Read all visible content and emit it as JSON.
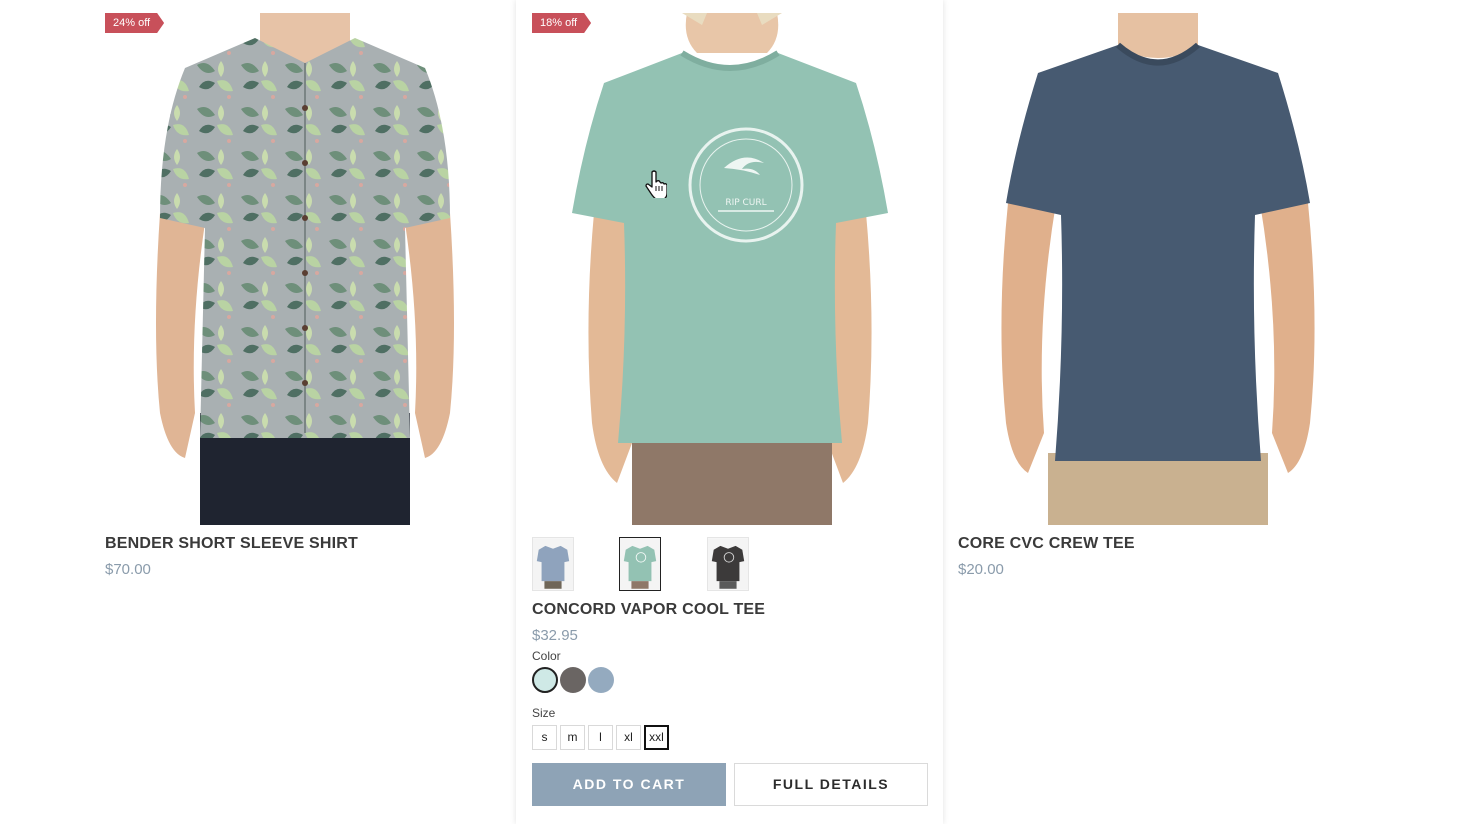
{
  "products": [
    {
      "badge": "24% off",
      "title": "BENDER SHORT SLEEVE SHIRT",
      "price": "$70.00",
      "image_icon": "floral-shirt-photo"
    },
    {
      "badge": "18% off",
      "title": "CONCORD VAPOR COOL TEE",
      "price": "$32.95",
      "image_icon": "mint-tee-photo",
      "thumbnails": [
        "blue-tee-thumbnail",
        "mint-tee-thumbnail",
        "charcoal-tee-thumbnail"
      ],
      "color_label": "Color",
      "colors": [
        "#cfe9e6",
        "#6a6563",
        "#94aabf"
      ],
      "size_label": "Size",
      "sizes": [
        "s",
        "m",
        "l",
        "xl",
        "xxl"
      ],
      "selected_size": "xxl",
      "add_to_cart": "ADD TO CART",
      "full_details": "FULL DETAILS"
    },
    {
      "title": "CORE CVC CREW TEE",
      "price": "$20.00",
      "image_icon": "navy-tee-photo"
    }
  ],
  "accent_colors": {
    "badge": "#c8505a",
    "price": "#8a9bab",
    "cart_button": "#8ea3b6"
  }
}
